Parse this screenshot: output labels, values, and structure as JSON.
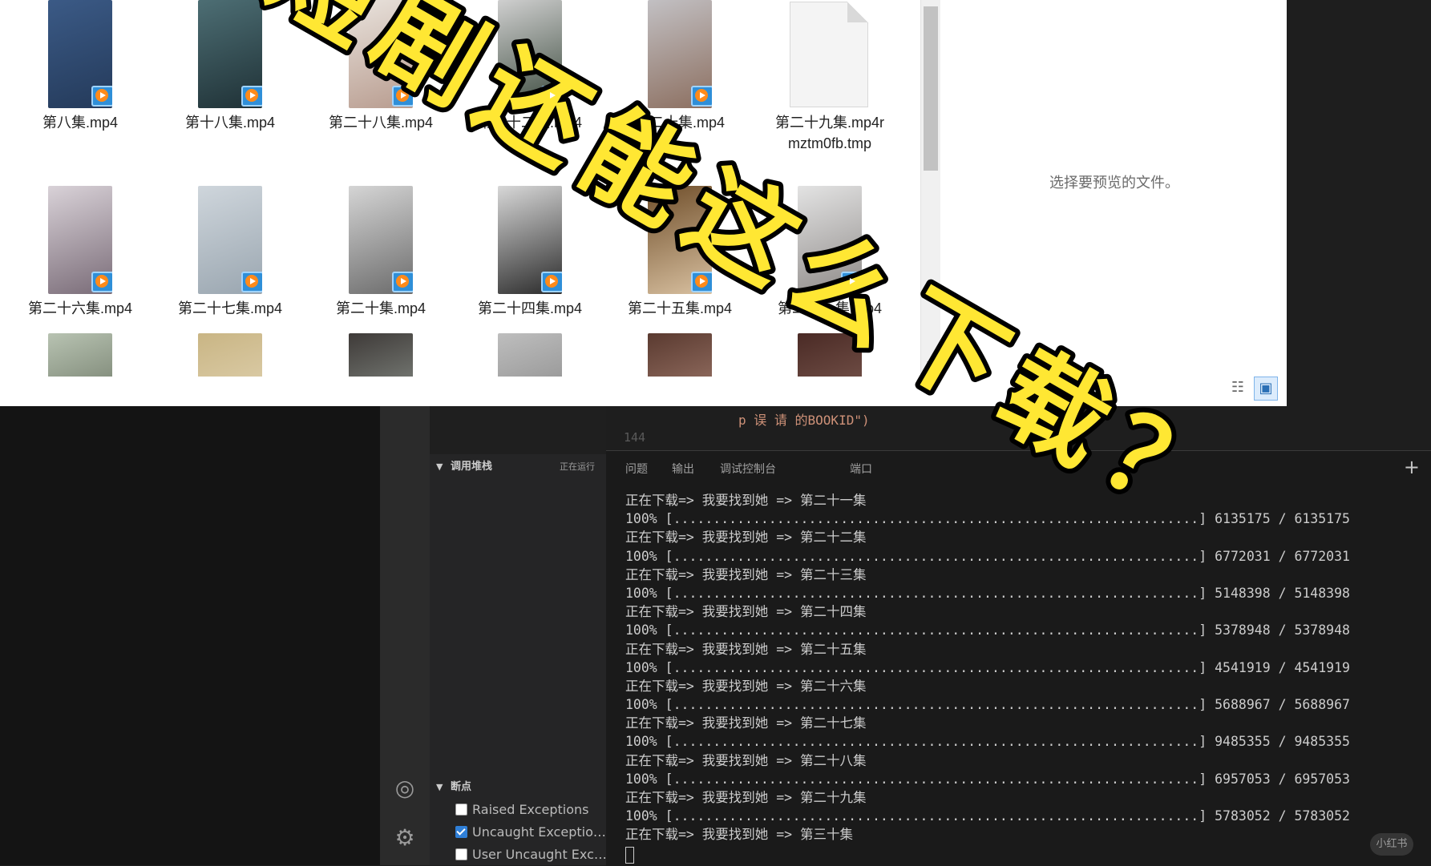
{
  "explorer": {
    "files": [
      {
        "name": "第八集.mp4",
        "thumb": [
          "#3b5a86",
          "#243a5a"
        ]
      },
      {
        "name": "第十八集.mp4",
        "thumb": [
          "#4d6e74",
          "#1f3136"
        ]
      },
      {
        "name": "第二十八集.mp4",
        "thumb": [
          "#e9e3dd",
          "#b89c8f"
        ]
      },
      {
        "name": "第二十二集.mp4",
        "thumb": [
          "#cfcfcf",
          "#3b4a3d"
        ]
      },
      {
        "name": "第二十集.mp4",
        "thumb": [
          "#c2c0c3",
          "#8c6f60"
        ]
      },
      {
        "name": "第二十九集.mp4rmztm0fb.tmp",
        "thumb": null
      },
      {
        "name": "第二十六集.mp4",
        "thumb": [
          "#d9d2d8",
          "#7a6c78"
        ]
      },
      {
        "name": "第二十七集.mp4",
        "thumb": [
          "#cfd6dc",
          "#9aa6b0"
        ]
      },
      {
        "name": "第二十集.mp4",
        "thumb": [
          "#d5d5d5",
          "#6c6c6c"
        ]
      },
      {
        "name": "第二十四集.mp4",
        "thumb": [
          "#d8d8d8",
          "#2b2b2b"
        ]
      },
      {
        "name": "第二十五集.mp4",
        "thumb": [
          "#6f4e2a",
          "#d8c0a0"
        ]
      },
      {
        "name": "第二十一集.mp4",
        "thumb": [
          "#e3e3e3",
          "#8e8a88"
        ]
      },
      {
        "name": "",
        "thumb": [
          "#b8c3b2",
          "#56604f"
        ]
      },
      {
        "name": "",
        "thumb": [
          "#c9b584",
          "#e8dcc0"
        ]
      },
      {
        "name": "",
        "thumb": [
          "#3e3a38",
          "#9fa8a0"
        ]
      },
      {
        "name": "",
        "thumb": [
          "#bebebe",
          "#7a7a7a"
        ]
      },
      {
        "name": "",
        "thumb": [
          "#5a3a30",
          "#b78f80"
        ]
      },
      {
        "name": "",
        "thumb": [
          "#4a2a25",
          "#8e6b60"
        ]
      }
    ],
    "preview_text": "选择要预览的文件。"
  },
  "vscode": {
    "editor": {
      "code_text": "p              误 请    的BOOKID\")",
      "line_number": "144"
    },
    "sidebar": {
      "callstack_title": "调用堆栈",
      "callstack_state": "正在运行",
      "breakpoints_title": "断点",
      "breakpoints": [
        {
          "label": "Raised Exceptions",
          "checked": false
        },
        {
          "label": "Uncaught Exceptions",
          "checked": true
        },
        {
          "label": "User Uncaught Exceptions",
          "checked": false
        }
      ]
    },
    "panel": {
      "tabs": [
        "问题",
        "输出",
        "调试控制台",
        "端口"
      ],
      "terminal_lines": [
        "正在下载=> 我要找到她 => 第二十一集",
        "100% [..................................................................] 6135175 / 6135175",
        "正在下载=> 我要找到她 => 第二十二集",
        "100% [..................................................................] 6772031 / 6772031",
        "正在下载=> 我要找到她 => 第二十三集",
        "100% [..................................................................] 5148398 / 5148398",
        "正在下载=> 我要找到她 => 第二十四集",
        "100% [..................................................................] 5378948 / 5378948",
        "正在下载=> 我要找到她 => 第二十五集",
        "100% [..................................................................] 4541919 / 4541919",
        "正在下载=> 我要找到她 => 第二十六集",
        "100% [..................................................................] 5688967 / 5688967",
        "正在下载=> 我要找到她 => 第二十七集",
        "100% [..................................................................] 9485355 / 9485355",
        "正在下载=> 我要找到她 => 第二十八集",
        "100% [..................................................................] 6957053 / 6957053",
        "正在下载=> 我要找到她 => 第二十九集",
        "100% [..................................................................] 5783052 / 5783052",
        "正在下载=> 我要找到她 => 第三十集"
      ]
    }
  },
  "overlay": {
    "caption_chars": [
      "短",
      "剧",
      "还",
      "能",
      "这",
      "么",
      "下",
      "载",
      "？"
    ]
  },
  "watermark": "小红书"
}
